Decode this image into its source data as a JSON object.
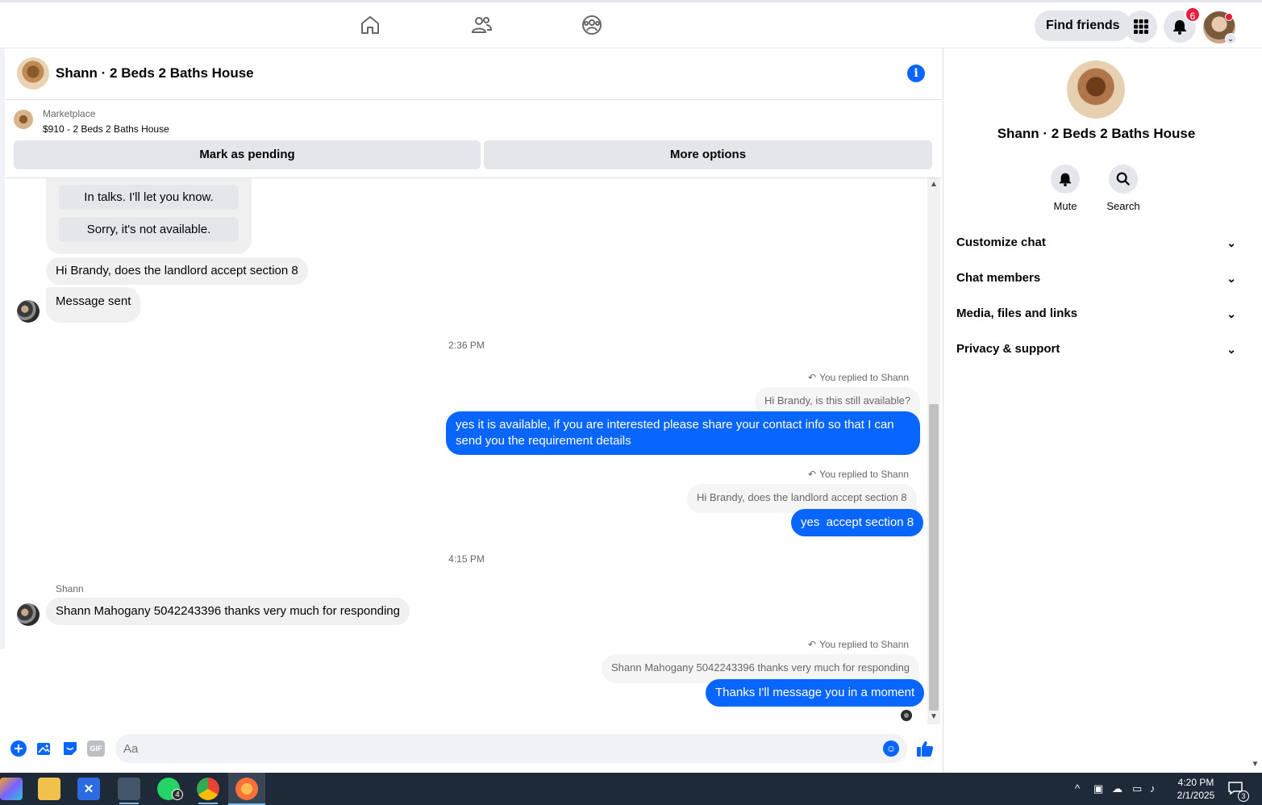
{
  "topnav": {
    "find_friends_label": "Find friends",
    "notifications_count": "6"
  },
  "chat": {
    "title": "Shann · 2 Beds 2 Baths House"
  },
  "marketplace": {
    "label": "Marketplace",
    "item": "$910 - 2 Beds 2 Baths House",
    "mark_pending_label": "Mark as pending",
    "more_options_label": "More options"
  },
  "messages": {
    "quick_replies": [
      "In talks. I'll let you know.",
      "Sorry, it's not available."
    ],
    "m1": "Hi Brandy, does the landlord accept section 8",
    "m2": "Message sent",
    "time1": "2:36 PM",
    "replied_label": "You replied to Shann",
    "quote1": "Hi Brandy, is this still available?",
    "reply1": "yes it is available, if you are interested please share your contact info so that I can send you the requirement details",
    "quote2": "Hi Brandy, does the landlord accept section 8",
    "reply2": "yes  accept section 8",
    "time2": "4:15 PM",
    "sender": "Shann",
    "m3": "Shann Mahogany 5042243396 thanks very much for responding",
    "quote3": "Shann Mahogany 5042243396 thanks very much for responding",
    "reply3": "Thanks I'll message you in a moment"
  },
  "composer": {
    "placeholder": "Aa",
    "gif_label": "GIF"
  },
  "right_panel": {
    "title": "Shann · 2 Beds 2 Baths House",
    "mute_label": "Mute",
    "search_label": "Search",
    "sections": [
      "Customize chat",
      "Chat members",
      "Media, files and links",
      "Privacy & support"
    ]
  },
  "taskbar": {
    "whatsapp_badge": "4",
    "time": "4:20 PM",
    "date": "2/1/2025",
    "notifications_badge": "3"
  },
  "colors": {
    "accent": "#0866ff",
    "bubble_in": "#f0f0f0",
    "taskbar": "#1f2a38"
  }
}
